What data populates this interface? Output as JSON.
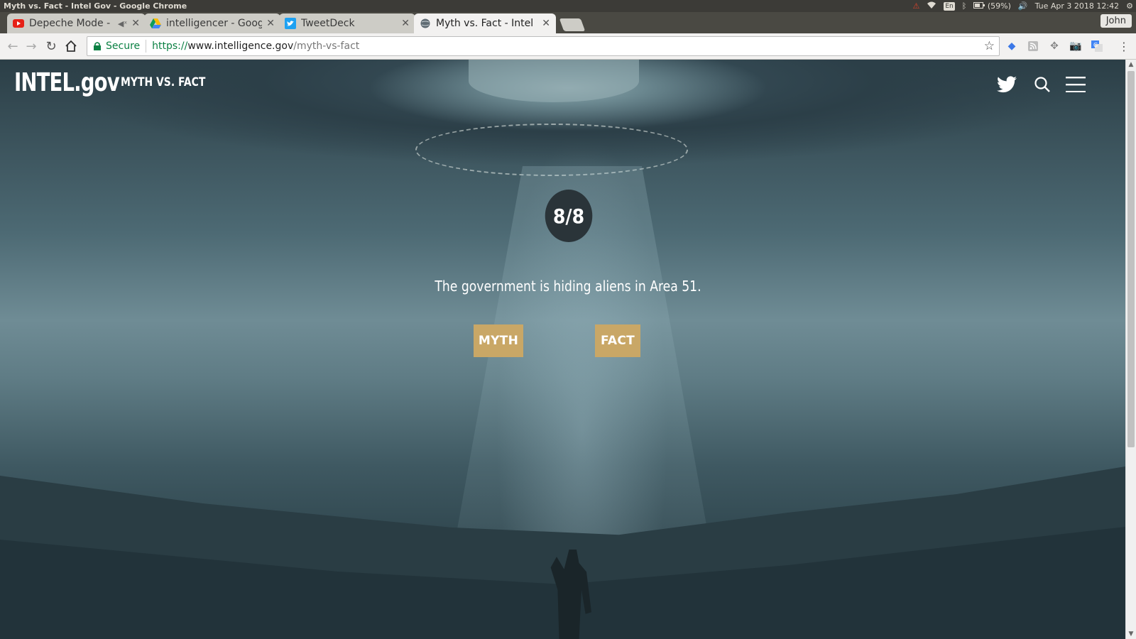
{
  "os": {
    "window_title": "Myth vs. Fact - Intel Gov - Google Chrome",
    "tray": {
      "lang": "En",
      "battery": "(59%)",
      "datetime": "Tue Apr  3 2018 12:42"
    }
  },
  "browser": {
    "tabs": [
      {
        "label": "Depeche Mode - ",
        "icon": "youtube-icon",
        "muted": true
      },
      {
        "label": "intelligencer - Goog",
        "icon": "google-drive-icon"
      },
      {
        "label": "TweetDeck",
        "icon": "twitter-icon"
      },
      {
        "label": "Myth vs. Fact - Intel",
        "icon": "globe-icon",
        "active": true
      }
    ],
    "profile": "John",
    "address": {
      "secure_label": "Secure",
      "scheme": "https://",
      "host": "www.intelligence.gov",
      "path": "/myth-vs-fact"
    }
  },
  "site": {
    "logo": "INTEL.gov",
    "section": "MYTH VS. FACT"
  },
  "quiz": {
    "counter": "8/8",
    "question": "The government is hiding aliens in Area 51.",
    "myth_label": "MYTH",
    "fact_label": "FACT"
  },
  "colors": {
    "accent": "#c9a766",
    "counter_bg": "#2a3439",
    "secure_green": "#0b8043"
  }
}
